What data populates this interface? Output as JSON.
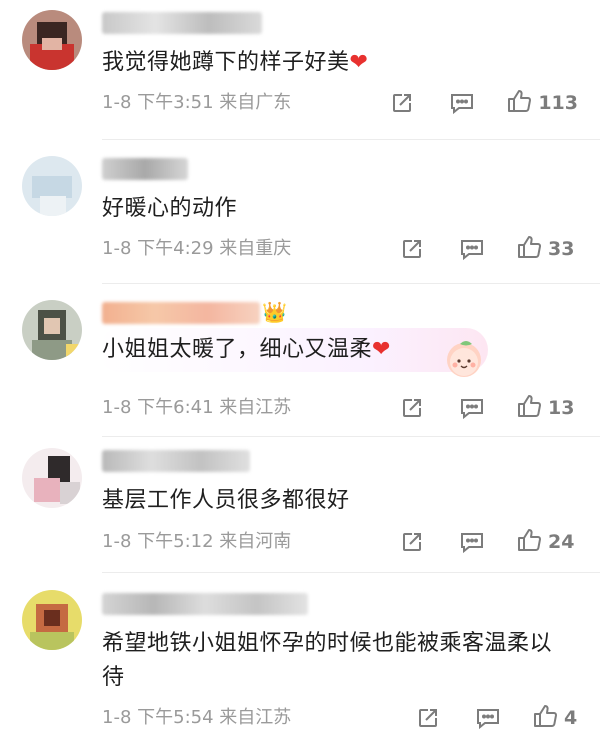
{
  "comments": [
    {
      "text": "我觉得她蹲下的样子好美",
      "heart": "❤",
      "date": "1-8",
      "time": "下午3:51",
      "location": "来自广东",
      "likes": "113"
    },
    {
      "text": "好暖心的动作",
      "heart": "",
      "date": "1-8",
      "time": "下午4:29",
      "location": "来自重庆",
      "likes": "33"
    },
    {
      "text": "小姐姐太暖了，细心又温柔",
      "heart": "❤",
      "date": "1-8",
      "time": "下午6:41",
      "location": "来自江苏",
      "likes": "13"
    },
    {
      "text": "基层工作人员很多都很好",
      "heart": "",
      "date": "1-8",
      "time": "下午5:12",
      "location": "来自河南",
      "likes": "24"
    },
    {
      "text": "希望地铁小姐姐怀孕的时候也能被乘客温柔以待",
      "heart": "",
      "date": "1-8",
      "time": "下午5:54",
      "location": "来自江苏",
      "likes": "4"
    }
  ],
  "icons": {
    "share": "share-icon",
    "reply": "reply-icon",
    "like": "thumbs-up-icon",
    "badge": "crown-icon",
    "decoration": "peach-sticker"
  },
  "colors": {
    "heart": "#e8312f",
    "meta": "#9a9a9a",
    "like_count": "#7c7c7c"
  }
}
